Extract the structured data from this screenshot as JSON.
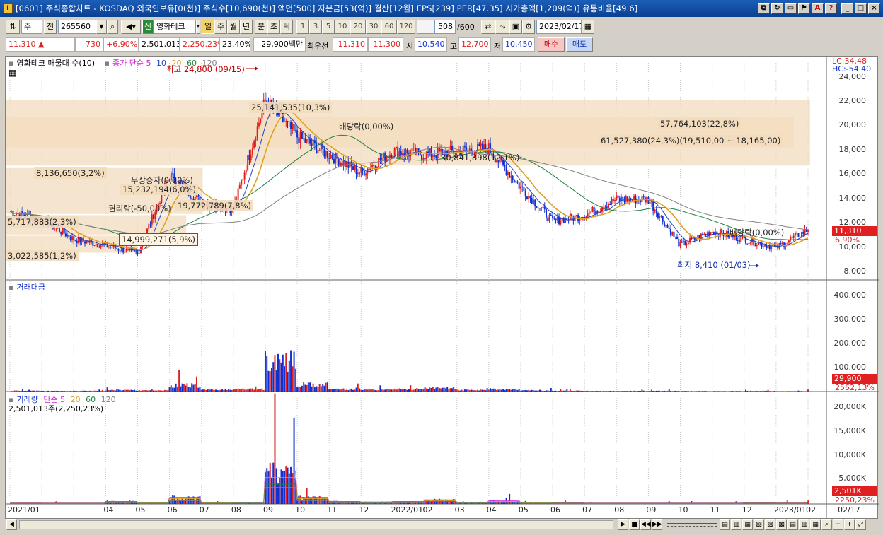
{
  "window": {
    "title": "[0601] 주식종합차트 - KOSDAQ 외국인보유[0(천)] 주식수[10,690(천)] 액면[500] 자본금[53(억)] 결산[12월] EPS[239] PER[47.35] 시가총액[1,209(억)] 유통비율[49.6]",
    "app_icon_text": "I"
  },
  "toolbar": {
    "type_select": "주",
    "prev_label": "전",
    "code": "265560",
    "stock_badge": "신",
    "stock_name": "영화테크",
    "periods": [
      "일",
      "주",
      "월",
      "년",
      "분",
      "초",
      "틱"
    ],
    "active_period": "일",
    "intervals": [
      "1",
      "3",
      "5",
      "10",
      "20",
      "30",
      "60",
      "120"
    ],
    "count": "508",
    "count_total": "/600",
    "date": "2023/02/17"
  },
  "quote": {
    "price": "11,310",
    "change": "730",
    "change_pct": "+6.90%",
    "volume": "2,501,013",
    "volume_pct": "2,250.23%",
    "turnover": "23.40%",
    "amount": "29,900백만",
    "best_ask_label": "최우선",
    "best_ask": "11,310",
    "best_bid": "11,300",
    "open_label": "시",
    "open": "10,540",
    "high_label": "고",
    "high": "12,700",
    "low_label": "저",
    "low": "10,450",
    "buy_label": "매수",
    "sell_label": "매도"
  },
  "price_panel": {
    "legend_title": "영화테크 매물대 수(10)",
    "ma_title": "종가 단순 5",
    "ma_periods": [
      "10",
      "20",
      "60",
      "120"
    ],
    "lc": "LC:34.48",
    "hc": "HC:-54.40",
    "high_note": "최고 24,800 (09/15)",
    "low_note": "최저 8,410 (01/03)",
    "last_price": "11,310",
    "last_pct": "6.90%",
    "y_ticks": [
      "24,000",
      "22,000",
      "20,000",
      "18,000",
      "16,000",
      "14,000",
      "12,000",
      "10,000",
      "8,000"
    ],
    "annotations": {
      "a1": "8,136,650(3,2%)",
      "a2": "15,232,194(6,0%)",
      "a3": "5,717,883(2,3%)",
      "a4": "19,772,789(7,8%)",
      "a5": "14,999,271(5,9%)",
      "a6": "3,022,585(1,2%)",
      "a7": "25,141,535(10,3%)",
      "a8": "57,764,103(22,8%)",
      "a9": "61,527,380(24,3%)(19,510,00 ~ 18,165,00)",
      "a10": "30,841,898(12,1%)",
      "e1": "무상증자(0,00%)",
      "e2": "권리락(-50,00%)",
      "e3": "배당락(0,00%)",
      "e4": "배당락(0,00%)"
    }
  },
  "amount_panel": {
    "title": "거래대금",
    "y_ticks": [
      "400,000",
      "300,000",
      "200,000",
      "100,000"
    ],
    "last_value": "29,900",
    "last_pct": "2562,13%"
  },
  "volume_panel": {
    "title": "거래량",
    "ma_title": "단순 5",
    "ma_periods": [
      "20",
      "60",
      "120"
    ],
    "sub": "2,501,013주(2,250,23%)",
    "y_ticks": [
      "20,000K",
      "15,000K",
      "10,000K",
      "5,000K"
    ],
    "last_value": "2,501K",
    "last_pct": "2250,23%"
  },
  "x_axis": [
    "2021/01",
    "04",
    "05",
    "06",
    "07",
    "08",
    "09",
    "10",
    "11",
    "12",
    "2022/01",
    "02",
    "03",
    "04",
    "05",
    "06",
    "07",
    "08",
    "09",
    "10",
    "11",
    "12",
    "2023/01",
    "02",
    "02/17"
  ],
  "colors": {
    "up": "#e02020",
    "down": "#1030d0",
    "ma5": "#d020d0",
    "ma10": "#2040c0",
    "ma20": "#e0a020",
    "ma60": "#208040",
    "ma120": "#808080",
    "zone": "#f3dcbe"
  },
  "chart_data": {
    "type": "candlestick",
    "note_series": "monthly close approximation",
    "x": [
      "2021/01",
      "2021/02",
      "2021/03",
      "2021/04",
      "2021/05",
      "2021/06",
      "2021/07",
      "2021/08",
      "2021/09",
      "2021/10",
      "2021/11",
      "2021/12",
      "2022/01",
      "2022/02",
      "2022/03",
      "2022/04",
      "2022/05",
      "2022/06",
      "2022/07",
      "2022/08",
      "2022/09",
      "2022/10",
      "2022/11",
      "2022/12",
      "2023/01",
      "2023/02"
    ],
    "close": [
      12800,
      12200,
      10500,
      10000,
      9300,
      15800,
      13500,
      13000,
      22000,
      19000,
      17500,
      16000,
      17800,
      17500,
      17800,
      18000,
      14800,
      12000,
      12500,
      13800,
      13800,
      10000,
      11200,
      10500,
      9800,
      11310
    ],
    "amount": [
      10000,
      8000,
      9000,
      20000,
      15000,
      80000,
      20000,
      30000,
      400000,
      90000,
      30000,
      25000,
      30000,
      45000,
      20000,
      30000,
      15000,
      10000,
      8000,
      8000,
      8000,
      6000,
      6000,
      8000,
      6000,
      29900
    ],
    "volume_k": [
      600,
      500,
      500,
      1500,
      800,
      4000,
      800,
      1000,
      20000,
      4000,
      1500,
      1200,
      1500,
      2500,
      1000,
      1800,
      800,
      700,
      500,
      500,
      500,
      500,
      500,
      700,
      600,
      2501
    ],
    "ylim": [
      7500,
      24800
    ],
    "amount_ylim": [
      0,
      430000
    ],
    "volume_ylim": [
      0,
      21500
    ]
  }
}
